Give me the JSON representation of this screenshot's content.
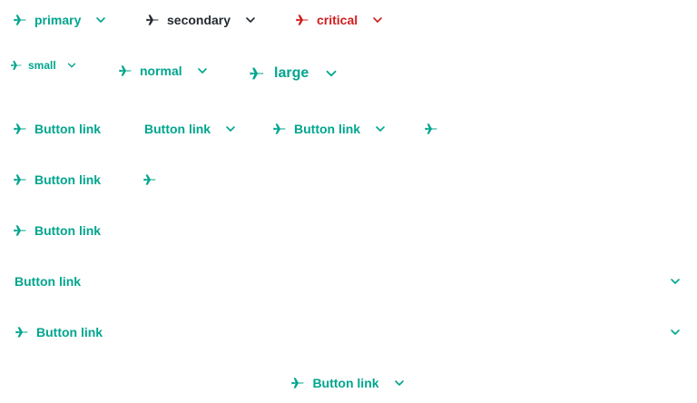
{
  "row1": {
    "primary_label": "primary",
    "secondary_label": "secondary",
    "critical_label": "critical"
  },
  "row2": {
    "small_label": "small",
    "normal_label": "normal",
    "large_label": "large"
  },
  "button_link_label": "Button link",
  "icons": {
    "leading": "airplane-icon",
    "trailing": "chevron-down-icon"
  },
  "colors": {
    "primary": "#00a58e",
    "secondary": "#252a31",
    "critical": "#d21c1c"
  }
}
